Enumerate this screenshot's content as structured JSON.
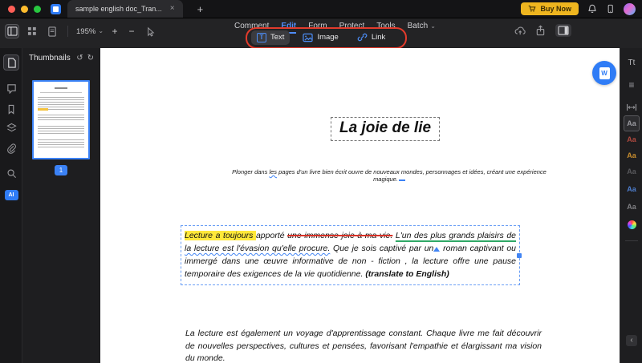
{
  "titlebar": {
    "tab_title": "sample english doc_Tran...",
    "buy_now_label": "Buy Now"
  },
  "toolbar": {
    "zoom_level": "195%",
    "menus": [
      "Comment",
      "Edit",
      "Form",
      "Protect",
      "Tools",
      "Batch"
    ],
    "buttons": {
      "text": "Text",
      "image": "Image",
      "link": "Link"
    }
  },
  "thumbnails_panel": {
    "title": "Thumbnails",
    "page_badge": "1"
  },
  "left_strip": {
    "ai_label": "AI"
  },
  "document": {
    "title": "La joie de lie",
    "subtitle": {
      "pre": "Plonger dans ",
      "marked": "les",
      "post": " pages d'un livre bien écrit ouvre de nouveaux mondes, personnages et idées, créant une expérience magique."
    },
    "paragraph1": {
      "highlighted": "Lecture a toujours ",
      "plain_a": "apporté ",
      "struck": "une immense joie à ma vie.",
      "sep": " ",
      "green_underlined": "L'un des plus grands plaisirs de ",
      "wavy_underlined": "la lecture est l'évasion qu'elle procure.",
      "plain_b": " Que je sois captivé par un",
      "plain_c": " roman captivant ou immergé dans une œuvre informative de non - fiction , la lecture offre une pause temporaire des exigences de la vie quotidienne. ",
      "bold_note": "(translate to English)"
    },
    "paragraph2": "La lecture est également un voyage d'apprentissage constant. Chaque livre me fait découvrir de nouvelles perspectives, cultures et pensées, favorisant l'empathie et élargissant ma vision du monde."
  },
  "right_panel": {
    "font_tool": "Tt",
    "swatch": "Aa"
  },
  "icons": {
    "close": "×",
    "plus": "+",
    "minus": "−",
    "chevron_down": "⌄",
    "rotate_left": "↺",
    "rotate_right": "↻",
    "chevron_left": "‹",
    "hamburger": "≡",
    "text_glyph": "T",
    "w_glyph": "W"
  },
  "colors": {
    "accent_blue": "#3c82f6",
    "annotation_red": "#e23b2c",
    "highlight_yellow": "#ffe83a",
    "buy_now_yellow": "#eeb51f",
    "strike_red": "#d73227",
    "underline_green": "#2fa866"
  }
}
